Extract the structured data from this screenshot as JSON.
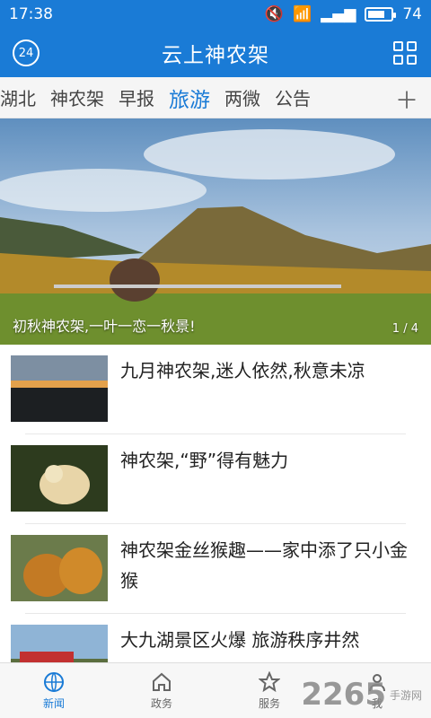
{
  "status": {
    "time": "17:38",
    "battery": "74",
    "battery_level": 0.74
  },
  "app": {
    "title": "云上神农架",
    "badge": "24"
  },
  "tabs": [
    "湖北",
    "神农架",
    "早报",
    "旅游",
    "两微",
    "公告"
  ],
  "tabs_active": "旅游",
  "banner": {
    "caption": "初秋神农架,一叶一恋一秋景!",
    "pager_current": "1",
    "pager_total": "4"
  },
  "news": [
    {
      "title": "九月神农架,迷人依然,秋意未凉"
    },
    {
      "title": "神农架,“野”得有魅力"
    },
    {
      "title": "神农架金丝猴趣——家中添了只小金猴"
    },
    {
      "title": "大九湖景区火爆 旅游秩序井然"
    }
  ],
  "nav": [
    {
      "label": "新闻",
      "icon": "globe-icon"
    },
    {
      "label": "政务",
      "icon": "home-icon"
    },
    {
      "label": "服务",
      "icon": "star-icon"
    },
    {
      "label": "我",
      "icon": "user-icon"
    }
  ],
  "watermark": {
    "main": "2265",
    "sub": "手游网"
  }
}
